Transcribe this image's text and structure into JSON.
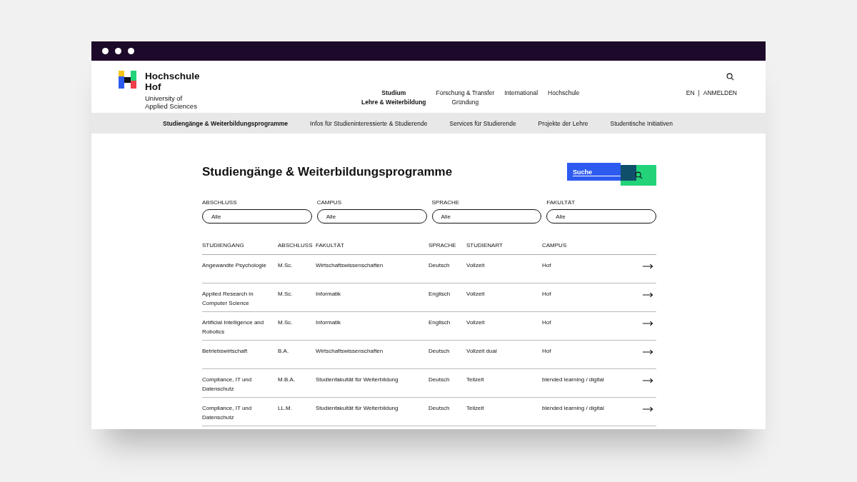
{
  "logo": {
    "name": "Hochschule Hof",
    "subtitle": "University of Applied Sciences"
  },
  "main_nav": [
    {
      "label": "Studium",
      "sublabel": "Lehre & Weiterbildung",
      "selected": true
    },
    {
      "label": "Forschung & Transfer",
      "sublabel": "Gründung",
      "selected": false
    },
    {
      "label": "International",
      "selected": false
    },
    {
      "label": "Hochschule",
      "selected": false
    }
  ],
  "language": "EN",
  "separator": "|",
  "login": "ANMELDEN",
  "sub_nav": [
    {
      "label": "Studiengänge & Weiterbildungsprogramme",
      "selected": true
    },
    {
      "label": "Infos für Studieninteressierte & Studierende",
      "selected": false
    },
    {
      "label": "Services für Studierende",
      "selected": false
    },
    {
      "label": "Projekte der Lehre",
      "selected": false
    },
    {
      "label": "Studentische Initiativen",
      "selected": false
    }
  ],
  "page_title": "Studiengänge & Weiterbildungsprogramme",
  "search": {
    "placeholder": "Suche"
  },
  "filters": [
    {
      "label": "ABSCHLUSS",
      "value": "Alle"
    },
    {
      "label": "CAMPUS",
      "value": "Alle"
    },
    {
      "label": "SPRACHE",
      "value": "Alle"
    },
    {
      "label": "FAKULTÄT",
      "value": "Alle"
    }
  ],
  "table": {
    "columns": [
      "STUDIENGANG",
      "ABSCHLUSS",
      "FAKULTÄT",
      "SPRACHE",
      "STUDIENART",
      "CAMPUS"
    ],
    "rows": [
      [
        "Angewandte Psychologie",
        "M.Sc.",
        "Wirtschaftswissenschaften",
        "Deutsch",
        "Vollzeit",
        "Hof"
      ],
      [
        "Applied Research in Computer Science",
        "M.Sc.",
        "Informatik",
        "Englisch",
        "Vollzeit",
        "Hof"
      ],
      [
        "Artificial Intelligence and Robotics",
        "M.Sc.",
        "Informatik",
        "Englisch",
        "Vollzeit",
        "Hof"
      ],
      [
        "Betriebswirtschaft",
        "B.A.",
        "Wirtschaftswissenschaften",
        "Deutsch",
        "Vollzeit dual",
        "Hof"
      ],
      [
        "Compliance, IT und Datenschutz",
        "M.B.A.",
        "Studienfakultät für Weiterbildung",
        "Deutsch",
        "Teilzeit",
        "blended learning / digital"
      ],
      [
        "Compliance, IT und Datenschutz",
        "LL.M.",
        "Studienfakultät für Weiterbildung",
        "Deutsch",
        "Teilzeit",
        "blended learning / digital"
      ]
    ]
  }
}
